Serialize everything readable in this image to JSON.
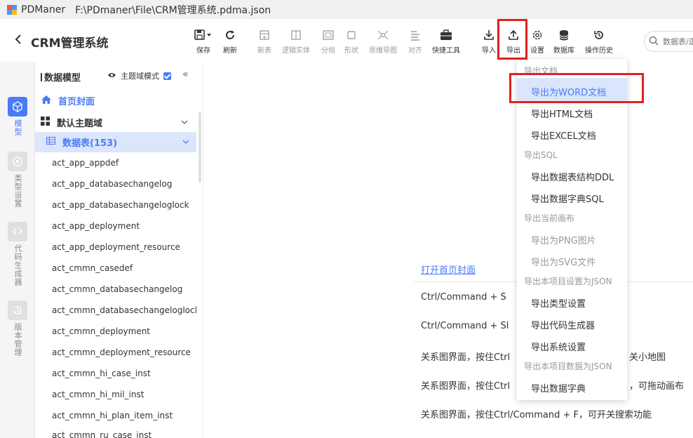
{
  "window": {
    "app_name": "PDManer",
    "file_path": "F:\\PDmaner\\File\\CRM管理系统.pdma.json"
  },
  "header": {
    "back_label": "<",
    "project_title": "CRM管理系统",
    "tools": [
      {
        "label": "保存"
      },
      {
        "label": "刷新"
      },
      {
        "label": "新表"
      },
      {
        "label": "逻辑实体"
      },
      {
        "label": "分组"
      },
      {
        "label": "形状"
      },
      {
        "label": "思维导图"
      },
      {
        "label": "对齐"
      },
      {
        "label": "快捷工具"
      },
      {
        "label": "导入"
      },
      {
        "label": "导出"
      },
      {
        "label": "设置"
      },
      {
        "label": "数据库"
      },
      {
        "label": "操作历史"
      }
    ],
    "search_placeholder": "数据表/逻"
  },
  "rail": {
    "items": [
      {
        "label": "模型"
      },
      {
        "label": "类型设置"
      },
      {
        "label": "代码生成器"
      },
      {
        "label": "版本管理"
      }
    ]
  },
  "panel": {
    "title": "数据模型",
    "theme_mode_label": "主题域模式",
    "collapse_label": "«",
    "home_label": "首页封面",
    "theme_label": "默认主题域",
    "tables_label": "数据表(153)",
    "tables": [
      "act_app_appdef",
      "act_app_databasechangelog",
      "act_app_databasechangeloglock",
      "act_app_deployment",
      "act_app_deployment_resource",
      "act_cmmn_casedef",
      "act_cmmn_databasechangelog",
      "act_cmmn_databasechangeloglocl",
      "act_cmmn_deployment",
      "act_cmmn_deployment_resource",
      "act_cmmn_hi_case_inst",
      "act_cmmn_hi_mil_inst",
      "act_cmmn_hi_plan_item_inst",
      "act_cmmn_ru_case_inst"
    ]
  },
  "main": {
    "open_home_link": "打开首页封面",
    "shortcuts": [
      "Ctrl/Command + S",
      "Ctrl/Command + Sl",
      "关系图界面，按住Ctrl",
      "关系图界面，按住Ctrl",
      "关系图界面，按住Ctrl/Command + F，可开关搜索功能"
    ],
    "shortcut_tails": [
      "关小地图",
      "，可拖动画布"
    ]
  },
  "export_menu": {
    "groups": {
      "doc": "导出文档",
      "sql": "导出SQL",
      "canvas": "导出当前画布",
      "settings_json": "导出本项目设置为JSON",
      "data_json": "导出本项目数据为JSON"
    },
    "items": {
      "word": "导出为WORD文档",
      "html": "导出HTML文档",
      "excel": "导出EXCEL文档",
      "ddl": "导出数据表结构DDL",
      "dict_sql": "导出数据字典SQL",
      "png": "导出为PNG图片",
      "svg": "导出为SVG文件",
      "type_settings": "导出类型设置",
      "code_gen": "导出代码生成器",
      "sys_settings": "导出系统设置",
      "data_dict": "导出数据字典"
    }
  },
  "colors": {
    "accent": "#4a7bf7",
    "highlight_box": "#e0211f",
    "selected_bg": "#dbe5fc"
  }
}
